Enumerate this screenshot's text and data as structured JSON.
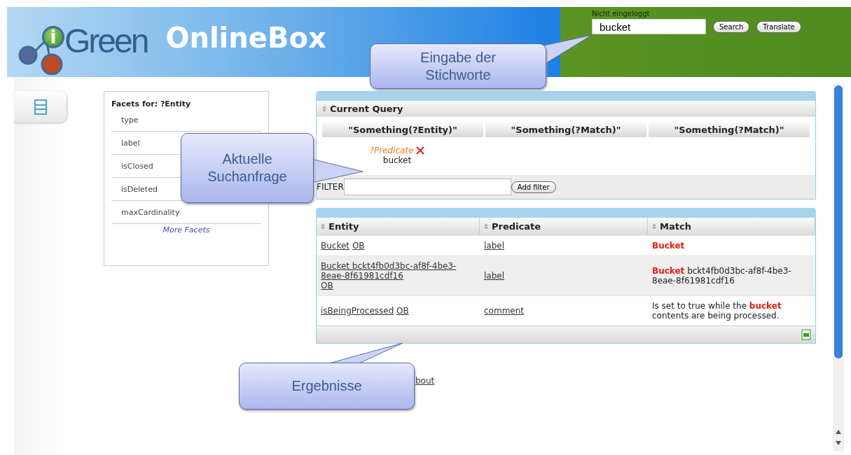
{
  "header": {
    "logo_badge": "i",
    "logo_text": "Green",
    "title": "OnlineBox",
    "login_status": "Nicht eingeloggt",
    "search": {
      "value": "bucket"
    },
    "buttons": [
      "Search",
      "Translate"
    ]
  },
  "facets": {
    "title": "Facets for: ?Entity",
    "items": [
      "type",
      "label",
      "isClosed",
      "isDeleted",
      "maxCardinality"
    ],
    "more": "More Facets"
  },
  "query": {
    "title": "Current Query",
    "columns": [
      "\"Something(?Entity)\"",
      "\"Something(?Match)\"",
      "\"Something(?Match)\""
    ],
    "term": {
      "variable": "?Predicate",
      "value": "bucket"
    },
    "filter": {
      "label": "FILTER",
      "button": "Add filter"
    }
  },
  "results": {
    "columns": [
      "Entity",
      "Predicate",
      "Match"
    ],
    "rows": [
      {
        "entity": [
          "Bucket",
          "OB"
        ],
        "predicate": "label",
        "match": "**Bucket**"
      },
      {
        "entity": [
          "Bucket bckt4fb0d3bc-af8f-4be3-8eae-8f61981cdf16",
          "OB"
        ],
        "predicate": "label",
        "match": "**Bucket** bckt4fb0d3bc-af8f-4be3-8eae-8f61981cdf16"
      },
      {
        "entity": [
          "isBeingProcessed",
          "OB"
        ],
        "predicate": "comment",
        "match": "Is set to true while the **bucket** contents are being processed."
      }
    ]
  },
  "footer_link": "bout",
  "callouts": [
    "Eingabe der Stichworte",
    "Aktuelle Suchanfrage",
    "Ergebnisse"
  ]
}
